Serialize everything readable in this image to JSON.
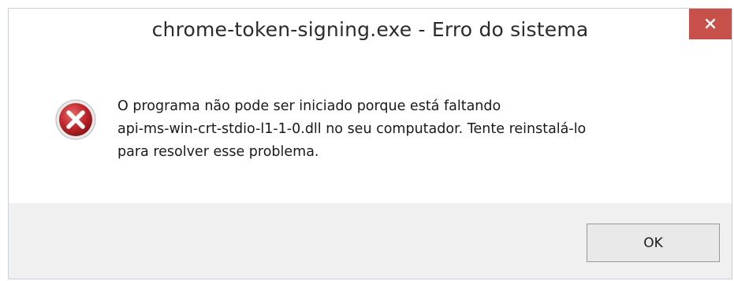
{
  "window": {
    "title": "chrome-token-signing.exe - Erro do sistema",
    "close_icon": "close-icon"
  },
  "content": {
    "icon": "error-icon",
    "message_lines": [
      "O programa não pode ser iniciado porque está faltando",
      "api-ms-win-crt-stdio-l1-1-0.dll no seu computador. Tente reinstalá-lo",
      "para resolver esse problema."
    ]
  },
  "footer": {
    "ok_label": "OK"
  },
  "colors": {
    "close_button": "#c7504a",
    "error_icon": "#c0282e",
    "footer_background": "#f0f0f0"
  }
}
